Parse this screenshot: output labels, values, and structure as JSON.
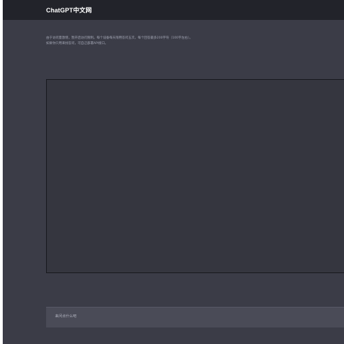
{
  "header": {
    "title": "ChatGPT中文网"
  },
  "notice": {
    "line1": "由于访问量激增，暂开启访问限制。每个设备每天限用答问五次，每个回答最多200字符（100字左右）。",
    "line2": "如果你只用来找答问，可自己部署API接口。"
  },
  "chat": {
    "messages": []
  },
  "input": {
    "placeholder": "来问点什么吧"
  },
  "colors": {
    "background": "#3b3c47",
    "topbar": "#22232a",
    "chat_area": "#35363f",
    "input_bar": "#4a4b57",
    "notice_text": "#a2a5b3"
  }
}
